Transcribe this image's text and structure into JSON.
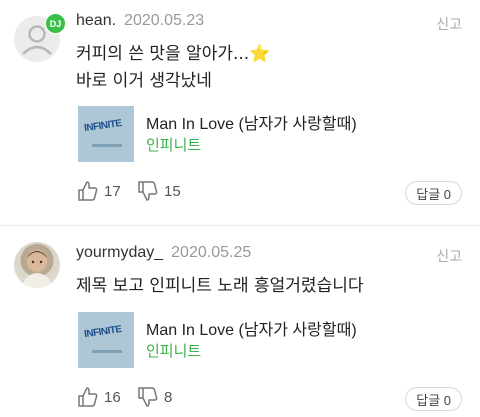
{
  "comments": [
    {
      "badge": "DJ",
      "username": "hean.",
      "date": "2020.05.23",
      "report_label": "신고",
      "text_line1": "커피의 쓴 맛을 알아가...⭐",
      "text_line2": "바로 이거 생각났네",
      "song": {
        "title": "Man In Love (남자가 사랑할때)",
        "artist": "인피니트",
        "thumb_text": "INFINITE"
      },
      "likes": "17",
      "dislikes": "15",
      "reply_label": "답글 0"
    },
    {
      "username": "yourmyday_",
      "date": "2020.05.25",
      "report_label": "신고",
      "text_line1": "제목 보고 인피니트 노래 흥얼거렸습니다",
      "song": {
        "title": "Man In Love (남자가 사랑할때)",
        "artist": "인피니트",
        "thumb_text": "INFINITE"
      },
      "likes": "16",
      "dislikes": "8",
      "reply_label": "답글 0"
    }
  ],
  "colors": {
    "accent": "#3bb14a",
    "muted": "#999999",
    "divider": "#ececec"
  },
  "icons": {
    "like": "thumb-up-icon",
    "dislike": "thumb-down-icon",
    "default_avatar": "user-icon"
  }
}
